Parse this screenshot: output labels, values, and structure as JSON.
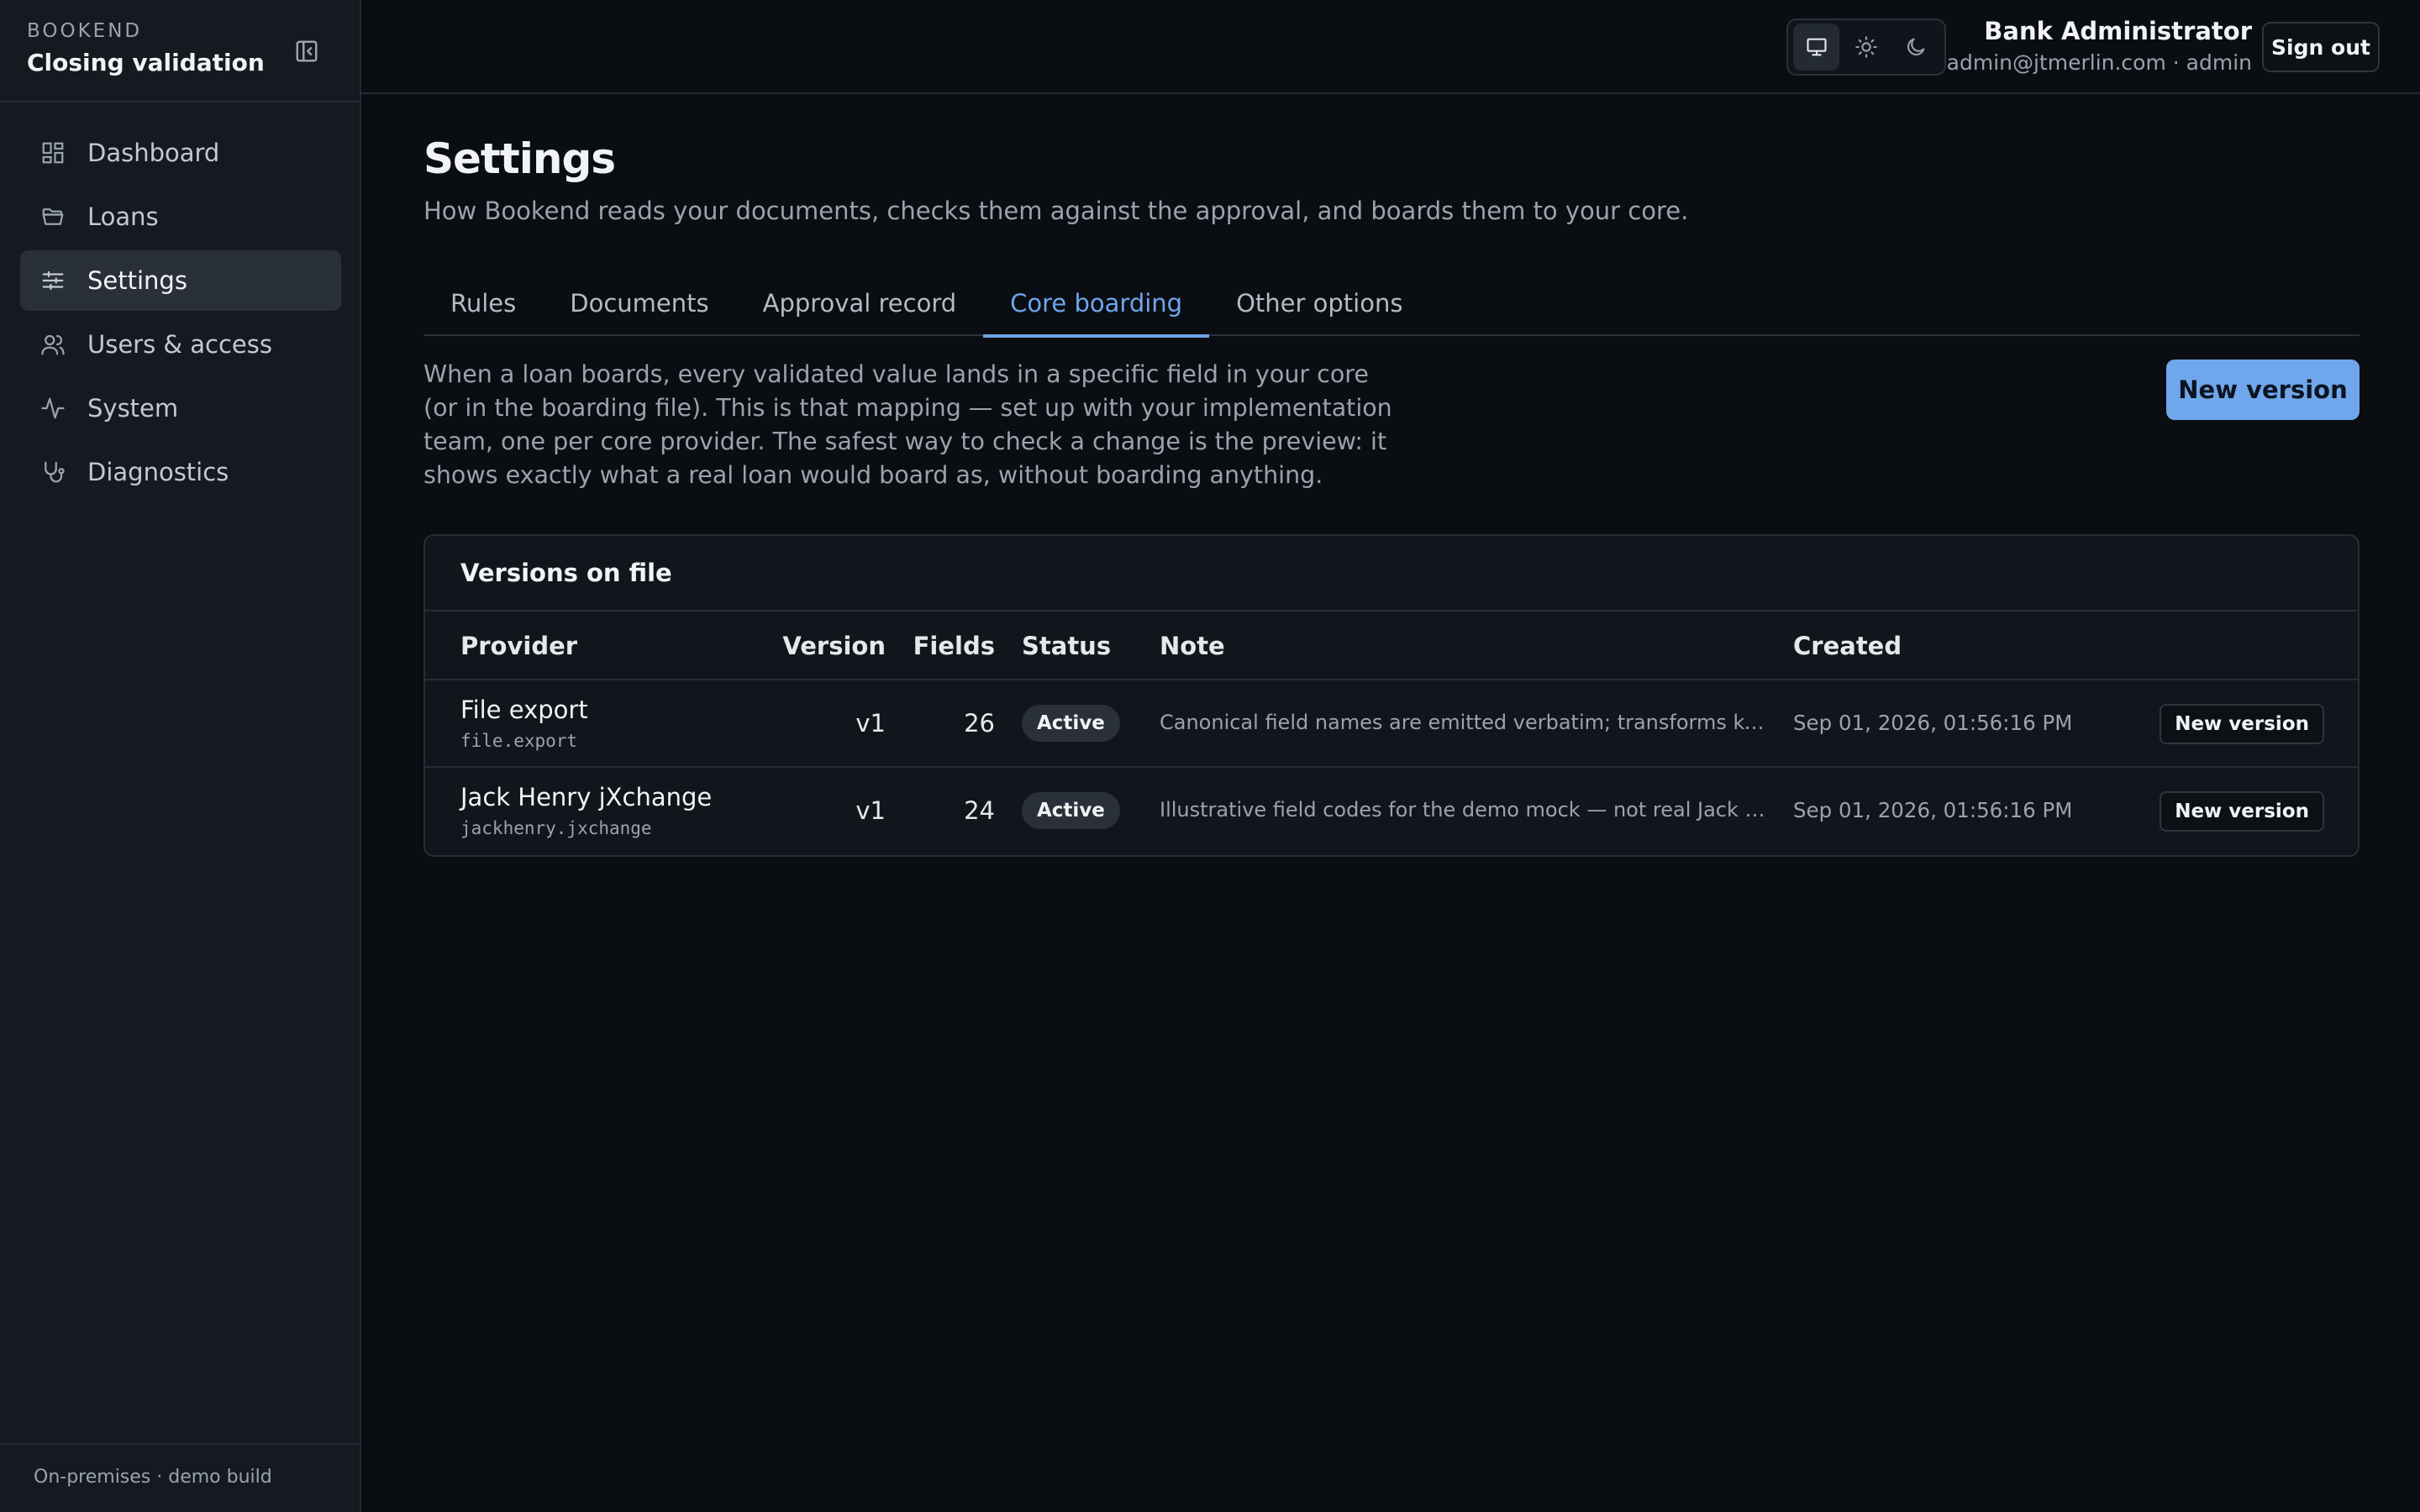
{
  "sidebar": {
    "brand_eyebrow": "BOOKEND",
    "brand_title": "Closing validation",
    "items": [
      {
        "label": "Dashboard",
        "icon": "dashboard-icon"
      },
      {
        "label": "Loans",
        "icon": "folder-icon"
      },
      {
        "label": "Settings",
        "icon": "sliders-icon",
        "active": true
      },
      {
        "label": "Users & access",
        "icon": "users-icon"
      },
      {
        "label": "System",
        "icon": "activity-icon"
      },
      {
        "label": "Diagnostics",
        "icon": "stethoscope-icon"
      }
    ],
    "footer": "On-premises · demo build"
  },
  "header": {
    "theme_options": [
      "system",
      "light",
      "dark"
    ],
    "theme_selected": "system",
    "user_name": "Bank Administrator",
    "user_sub": "admin@jtmerlin.com · admin",
    "sign_out": "Sign out"
  },
  "main": {
    "title": "Settings",
    "subtitle": "How Bookend reads your documents, checks them against the approval, and boards them to your core.",
    "tabs": [
      {
        "label": "Rules"
      },
      {
        "label": "Documents"
      },
      {
        "label": "Approval record"
      },
      {
        "label": "Core boarding",
        "active": true
      },
      {
        "label": "Other options"
      }
    ],
    "intro": "When a loan boards, every validated value lands in a specific field in your core (or in the boarding file). This is that mapping — set up with your implementation team, one per core provider. The safest way to check a change is the preview: it shows exactly what a real loan would board as, without boarding anything.",
    "new_version_label": "New version",
    "versions": {
      "title": "Versions on file",
      "columns": {
        "provider": "Provider",
        "version": "Version",
        "fields": "Fields",
        "status": "Status",
        "note": "Note",
        "created": "Created"
      },
      "rows": [
        {
          "provider": "File export",
          "code": "file.export",
          "version": "v1",
          "fields": "26",
          "status": "Active",
          "note": "Canonical field names are emitted verbatim; transforms keep...",
          "created": "Sep 01, 2026, 01:56:16 PM",
          "action": "New version"
        },
        {
          "provider": "Jack Henry jXchange",
          "code": "jackhenry.jxchange",
          "version": "v1",
          "fields": "24",
          "status": "Active",
          "note": "Illustrative field codes for the demo mock — not real Jack He...",
          "created": "Sep 01, 2026, 01:56:16 PM",
          "action": "New version"
        }
      ]
    }
  },
  "colors": {
    "background": "#0a0d12",
    "sidebar": "#151a21",
    "accent": "#6fa6ec",
    "muted_text": "#9aa3ad"
  }
}
